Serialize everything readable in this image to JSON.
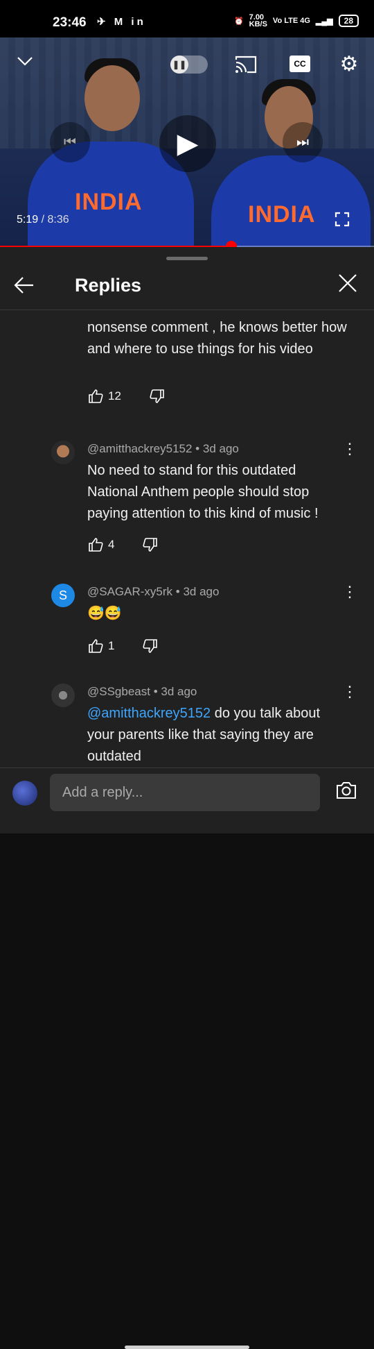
{
  "status_bar": {
    "time": "23:46",
    "left_icons": "✈ M in",
    "speed": "7.00\nKB/S",
    "network": "Vo LTE  4G",
    "battery": "28"
  },
  "video": {
    "current_time": "5:19",
    "duration": "8:36",
    "separator": " / ",
    "progress": 0.619,
    "jersey_text": "INDIA",
    "cc_label": "CC"
  },
  "sheet": {
    "title": "Replies"
  },
  "comments": [
    {
      "author": "",
      "age": "",
      "text": "nonsense comment , he knows better how and where to use things for his video",
      "likes": "12"
    },
    {
      "author": "@amitthackrey5152",
      "age": "3d ago",
      "text": "No need to stand for this outdated National Anthem people should stop paying attention to this kind of music !",
      "likes": "4"
    },
    {
      "author": "@SAGAR-xy5rk",
      "age": "3d ago",
      "avatar_letter": "S",
      "avatar_color": "#1e88e5",
      "text": "😅😅",
      "likes": "1"
    },
    {
      "author": "@SSgbeast",
      "age": "3d ago",
      "mention": "@amitthackrey5152",
      "text": " do you talk about your parents like that saying they are outdated",
      "likes": ""
    }
  ],
  "reply_bar": {
    "placeholder": "Add a reply..."
  },
  "colors": {
    "accent": "#ff0000",
    "mention": "#3ea6ff",
    "sheet_bg": "#212121"
  }
}
